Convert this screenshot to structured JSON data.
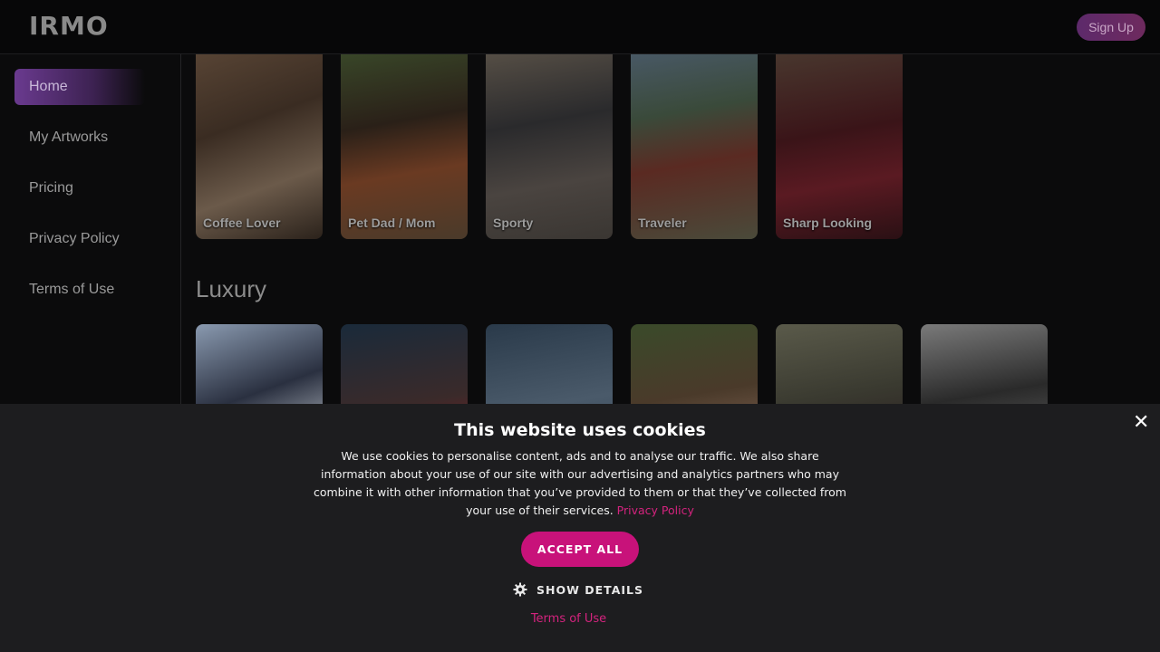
{
  "header": {
    "logo": "IRMO",
    "signup_label": "Sign Up"
  },
  "sidebar": {
    "items": [
      {
        "label": "Home",
        "active": true
      },
      {
        "label": "My Artworks"
      },
      {
        "label": "Pricing"
      },
      {
        "label": "Privacy Policy"
      },
      {
        "label": "Terms of Use"
      }
    ]
  },
  "main": {
    "top_row": [
      {
        "label": "Coffee Lover"
      },
      {
        "label": "Pet Dad / Mom"
      },
      {
        "label": "Sporty"
      },
      {
        "label": "Traveler"
      },
      {
        "label": "Sharp Looking"
      }
    ],
    "luxury": {
      "title": "Luxury"
    }
  },
  "cookie": {
    "title": "This website uses cookies",
    "body": "We use cookies to personalise content, ads and to analyse our traffic. We also share information about your use of our site with our advertising and analytics partners who may combine it with other information that you’ve provided to them or that they’ve collected from your use of their services.",
    "privacy_link": "Privacy Policy",
    "accept_label": "ACCEPT ALL",
    "details_label": "SHOW DETAILS",
    "terms_link": "Terms of Use",
    "close_label": "✕"
  }
}
